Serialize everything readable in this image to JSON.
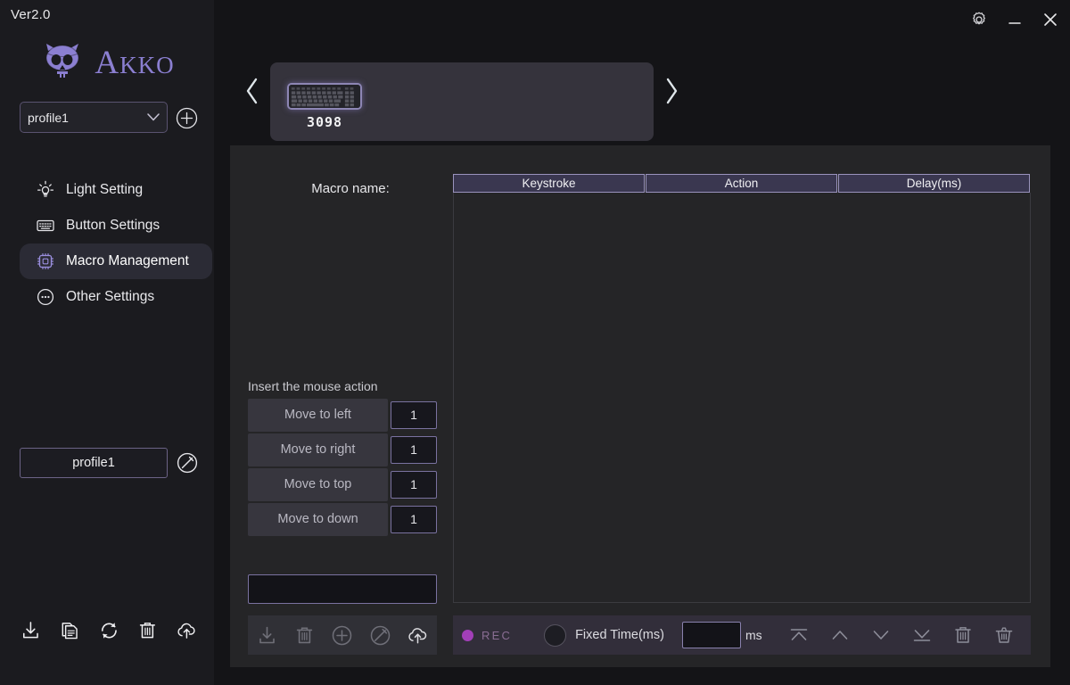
{
  "app": {
    "version_label": "Ver2.0",
    "brand": "AKKO",
    "accent": "#8b7fd1",
    "rec_accent": "#a23fb8",
    "panel_bg": "#252527",
    "sidebar_bg": "#1b1b1f"
  },
  "window_controls": {
    "settings": "gear-icon",
    "minimize": "minimize-icon",
    "close": "close-icon"
  },
  "sidebar": {
    "profile_select": {
      "value": "profile1",
      "placeholder": "profile1"
    },
    "add_profile_label": "+",
    "items": [
      {
        "label": "Light Setting",
        "icon": "light-bulb-icon",
        "active": false
      },
      {
        "label": "Button Settings",
        "icon": "keyboard-icon",
        "active": false
      },
      {
        "label": "Macro Management",
        "icon": "chip-icon",
        "active": true
      },
      {
        "label": "Other Settings",
        "icon": "dots-circle-icon",
        "active": false
      }
    ],
    "profile_name": {
      "value": "profile1"
    },
    "tools": [
      {
        "name": "download-icon"
      },
      {
        "name": "duplicate-icon"
      },
      {
        "name": "sync-icon"
      },
      {
        "name": "delete-icon"
      },
      {
        "name": "cloud-upload-icon"
      }
    ]
  },
  "device_strip": {
    "prev_label": "‹",
    "next_label": "›",
    "device": {
      "name": "3098",
      "thumb": "keyboard-thumbnail"
    }
  },
  "main": {
    "macro_name_label": "Macro name:",
    "insert_mouse_action_label": "Insert the mouse action",
    "mouse_actions": [
      {
        "label": "Move to left",
        "value": "1"
      },
      {
        "label": "Move to right",
        "value": "1"
      },
      {
        "label": "Move to top",
        "value": "1"
      },
      {
        "label": "Move to down",
        "value": "1"
      }
    ],
    "macro_name_input": {
      "value": "",
      "placeholder": ""
    },
    "left_tools": [
      {
        "name": "import-icon"
      },
      {
        "name": "delete-icon"
      },
      {
        "name": "add-icon"
      },
      {
        "name": "edit-icon"
      },
      {
        "name": "export-cloud-icon"
      }
    ],
    "table": {
      "columns": [
        "Keystroke",
        "Action",
        "Delay(ms)"
      ],
      "rows": []
    },
    "record_bar": {
      "rec_label": "REC",
      "fixed_time_label": "Fixed Time(ms)",
      "fixed_time_value": "",
      "ms_label": "ms",
      "order_tools": [
        {
          "name": "move-to-top-icon"
        },
        {
          "name": "move-up-icon"
        },
        {
          "name": "move-down-icon"
        },
        {
          "name": "move-to-bottom-icon"
        },
        {
          "name": "delete-row-icon"
        },
        {
          "name": "clear-all-icon"
        }
      ]
    }
  }
}
